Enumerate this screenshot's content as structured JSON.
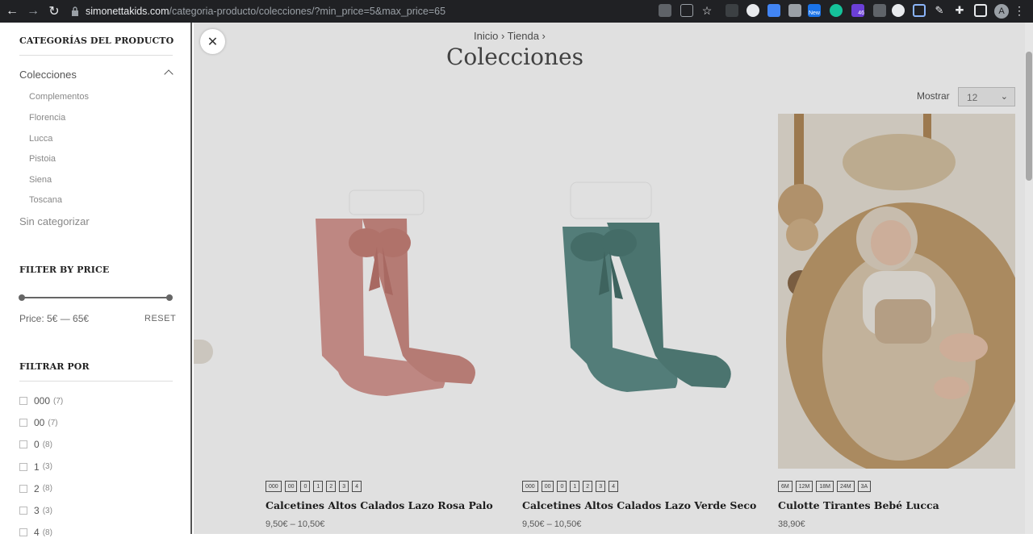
{
  "browser": {
    "back_icon": "back-arrow-icon",
    "forward_icon": "forward-arrow-icon",
    "reload_icon": "reload-icon",
    "url_host": "simonettakids.com",
    "url_path": "/categoria-producto/colecciones/?min_price=5&max_price=65",
    "profile_initial": "A",
    "ext_badge_new": "New",
    "ext_badge_count": "46"
  },
  "sidebar": {
    "categories_heading": "CATEGORÍAS DEL PRODUCTO",
    "category_main": "Colecciones",
    "subcategories": [
      "Complementos",
      "Florencia",
      "Lucca",
      "Pistoia",
      "Siena",
      "Toscana"
    ],
    "uncategorized": "Sin categorizar",
    "price_heading": "FILTER BY PRICE",
    "price_text": "Price: 5€ — 65€",
    "price_min": 5,
    "price_max": 65,
    "reset_label": "RESET",
    "filter_heading": "FILTRAR POR",
    "filters": [
      {
        "label": "000",
        "count": "(7)"
      },
      {
        "label": "00",
        "count": "(7)"
      },
      {
        "label": "0",
        "count": "(8)"
      },
      {
        "label": "1",
        "count": "(3)"
      },
      {
        "label": "2",
        "count": "(8)"
      },
      {
        "label": "3",
        "count": "(3)"
      },
      {
        "label": "4",
        "count": "(8)"
      }
    ]
  },
  "main": {
    "breadcrumb": "Inicio  ›  Tienda  ›",
    "title": "Colecciones",
    "mostrar_label": "Mostrar",
    "mostrar_value": "12",
    "products": [
      {
        "name": "Calcetines Altos Calados Lazo Rosa Palo",
        "price": "9,50€ – 10,50€",
        "sizes": [
          "000",
          "00",
          "0",
          "1",
          "2",
          "3",
          "4"
        ],
        "color": "#d99a94"
      },
      {
        "name": "Calcetines Altos Calados Lazo Verde Seco",
        "price": "9,50€ – 10,50€",
        "sizes": [
          "000",
          "00",
          "0",
          "1",
          "2",
          "3",
          "4"
        ],
        "color": "#5f8f8a"
      },
      {
        "name": "Culotte Tirantes Bebé Lucca",
        "price": "38,90€",
        "sizes": [
          "6M",
          "12M",
          "18M",
          "24M",
          "3A"
        ],
        "color": "#b39a78"
      }
    ]
  },
  "close_icon": "close-icon"
}
